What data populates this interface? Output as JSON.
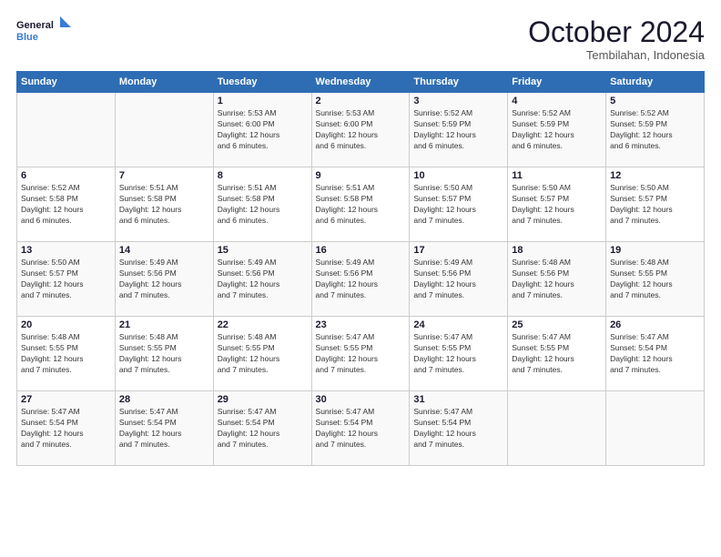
{
  "header": {
    "logo_line1": "General",
    "logo_line2": "Blue",
    "month": "October 2024",
    "location": "Tembilahan, Indonesia"
  },
  "weekdays": [
    "Sunday",
    "Monday",
    "Tuesday",
    "Wednesday",
    "Thursday",
    "Friday",
    "Saturday"
  ],
  "weeks": [
    [
      {
        "num": "",
        "info": ""
      },
      {
        "num": "",
        "info": ""
      },
      {
        "num": "1",
        "info": "Sunrise: 5:53 AM\nSunset: 6:00 PM\nDaylight: 12 hours\nand 6 minutes."
      },
      {
        "num": "2",
        "info": "Sunrise: 5:53 AM\nSunset: 6:00 PM\nDaylight: 12 hours\nand 6 minutes."
      },
      {
        "num": "3",
        "info": "Sunrise: 5:52 AM\nSunset: 5:59 PM\nDaylight: 12 hours\nand 6 minutes."
      },
      {
        "num": "4",
        "info": "Sunrise: 5:52 AM\nSunset: 5:59 PM\nDaylight: 12 hours\nand 6 minutes."
      },
      {
        "num": "5",
        "info": "Sunrise: 5:52 AM\nSunset: 5:59 PM\nDaylight: 12 hours\nand 6 minutes."
      }
    ],
    [
      {
        "num": "6",
        "info": "Sunrise: 5:52 AM\nSunset: 5:58 PM\nDaylight: 12 hours\nand 6 minutes."
      },
      {
        "num": "7",
        "info": "Sunrise: 5:51 AM\nSunset: 5:58 PM\nDaylight: 12 hours\nand 6 minutes."
      },
      {
        "num": "8",
        "info": "Sunrise: 5:51 AM\nSunset: 5:58 PM\nDaylight: 12 hours\nand 6 minutes."
      },
      {
        "num": "9",
        "info": "Sunrise: 5:51 AM\nSunset: 5:58 PM\nDaylight: 12 hours\nand 6 minutes."
      },
      {
        "num": "10",
        "info": "Sunrise: 5:50 AM\nSunset: 5:57 PM\nDaylight: 12 hours\nand 7 minutes."
      },
      {
        "num": "11",
        "info": "Sunrise: 5:50 AM\nSunset: 5:57 PM\nDaylight: 12 hours\nand 7 minutes."
      },
      {
        "num": "12",
        "info": "Sunrise: 5:50 AM\nSunset: 5:57 PM\nDaylight: 12 hours\nand 7 minutes."
      }
    ],
    [
      {
        "num": "13",
        "info": "Sunrise: 5:50 AM\nSunset: 5:57 PM\nDaylight: 12 hours\nand 7 minutes."
      },
      {
        "num": "14",
        "info": "Sunrise: 5:49 AM\nSunset: 5:56 PM\nDaylight: 12 hours\nand 7 minutes."
      },
      {
        "num": "15",
        "info": "Sunrise: 5:49 AM\nSunset: 5:56 PM\nDaylight: 12 hours\nand 7 minutes."
      },
      {
        "num": "16",
        "info": "Sunrise: 5:49 AM\nSunset: 5:56 PM\nDaylight: 12 hours\nand 7 minutes."
      },
      {
        "num": "17",
        "info": "Sunrise: 5:49 AM\nSunset: 5:56 PM\nDaylight: 12 hours\nand 7 minutes."
      },
      {
        "num": "18",
        "info": "Sunrise: 5:48 AM\nSunset: 5:56 PM\nDaylight: 12 hours\nand 7 minutes."
      },
      {
        "num": "19",
        "info": "Sunrise: 5:48 AM\nSunset: 5:55 PM\nDaylight: 12 hours\nand 7 minutes."
      }
    ],
    [
      {
        "num": "20",
        "info": "Sunrise: 5:48 AM\nSunset: 5:55 PM\nDaylight: 12 hours\nand 7 minutes."
      },
      {
        "num": "21",
        "info": "Sunrise: 5:48 AM\nSunset: 5:55 PM\nDaylight: 12 hours\nand 7 minutes."
      },
      {
        "num": "22",
        "info": "Sunrise: 5:48 AM\nSunset: 5:55 PM\nDaylight: 12 hours\nand 7 minutes."
      },
      {
        "num": "23",
        "info": "Sunrise: 5:47 AM\nSunset: 5:55 PM\nDaylight: 12 hours\nand 7 minutes."
      },
      {
        "num": "24",
        "info": "Sunrise: 5:47 AM\nSunset: 5:55 PM\nDaylight: 12 hours\nand 7 minutes."
      },
      {
        "num": "25",
        "info": "Sunrise: 5:47 AM\nSunset: 5:55 PM\nDaylight: 12 hours\nand 7 minutes."
      },
      {
        "num": "26",
        "info": "Sunrise: 5:47 AM\nSunset: 5:54 PM\nDaylight: 12 hours\nand 7 minutes."
      }
    ],
    [
      {
        "num": "27",
        "info": "Sunrise: 5:47 AM\nSunset: 5:54 PM\nDaylight: 12 hours\nand 7 minutes."
      },
      {
        "num": "28",
        "info": "Sunrise: 5:47 AM\nSunset: 5:54 PM\nDaylight: 12 hours\nand 7 minutes."
      },
      {
        "num": "29",
        "info": "Sunrise: 5:47 AM\nSunset: 5:54 PM\nDaylight: 12 hours\nand 7 minutes."
      },
      {
        "num": "30",
        "info": "Sunrise: 5:47 AM\nSunset: 5:54 PM\nDaylight: 12 hours\nand 7 minutes."
      },
      {
        "num": "31",
        "info": "Sunrise: 5:47 AM\nSunset: 5:54 PM\nDaylight: 12 hours\nand 7 minutes."
      },
      {
        "num": "",
        "info": ""
      },
      {
        "num": "",
        "info": ""
      }
    ]
  ]
}
